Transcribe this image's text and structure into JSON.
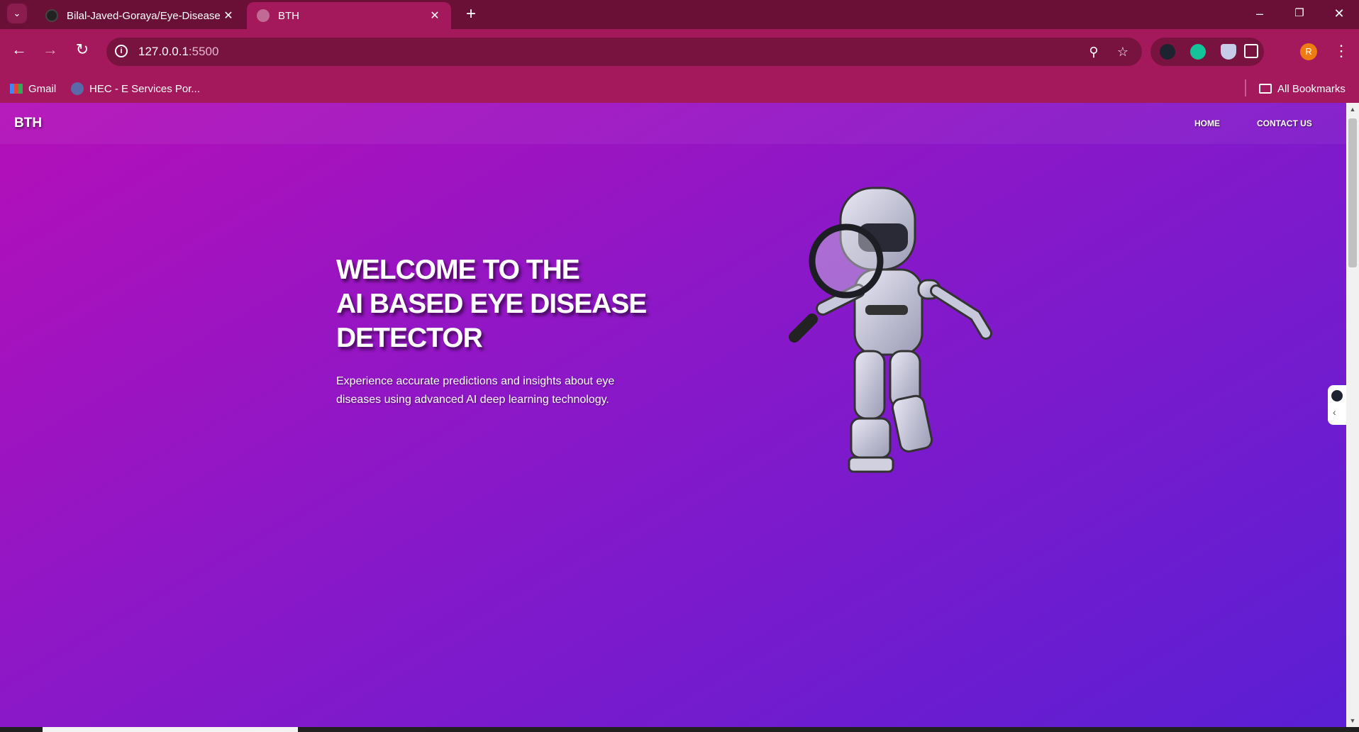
{
  "browser": {
    "tabs": [
      {
        "title": "Bilal-Javed-Goraya/Eye-Disease",
        "active": false
      },
      {
        "title": "BTH",
        "active": true
      }
    ],
    "url_host": "127.0.0.1",
    "url_port": ":5500",
    "bookmarks": [
      {
        "label": "Gmail",
        "icon": "gmail-icon"
      },
      {
        "label": "HEC - E Services Por...",
        "icon": "hec-icon"
      }
    ],
    "all_bookmarks": "All Bookmarks",
    "profile_initial": "R",
    "icons": {
      "tab_close": "✕",
      "new_tab": "+",
      "back": "←",
      "forward": "→",
      "reload": "↻",
      "zoom": "⚲",
      "star": "☆",
      "minimize": "–",
      "restore": "❐",
      "close": "✕",
      "menu": "⋮"
    }
  },
  "site": {
    "brand": "BTH",
    "nav": [
      "HOME",
      "CONTACT US"
    ],
    "hero": {
      "title_lines": [
        "WELCOME TO THE",
        "AI BASED EYE DISEASE",
        "DETECTOR"
      ],
      "subtitle": "Experience accurate predictions and insights about eye diseases using advanced AI deep learning technology."
    }
  },
  "colors": {
    "tabstrip": "#6a1036",
    "toolbar": "#a3195b",
    "gradient_start": "#b40fb8",
    "gradient_end": "#5b1fd4"
  }
}
